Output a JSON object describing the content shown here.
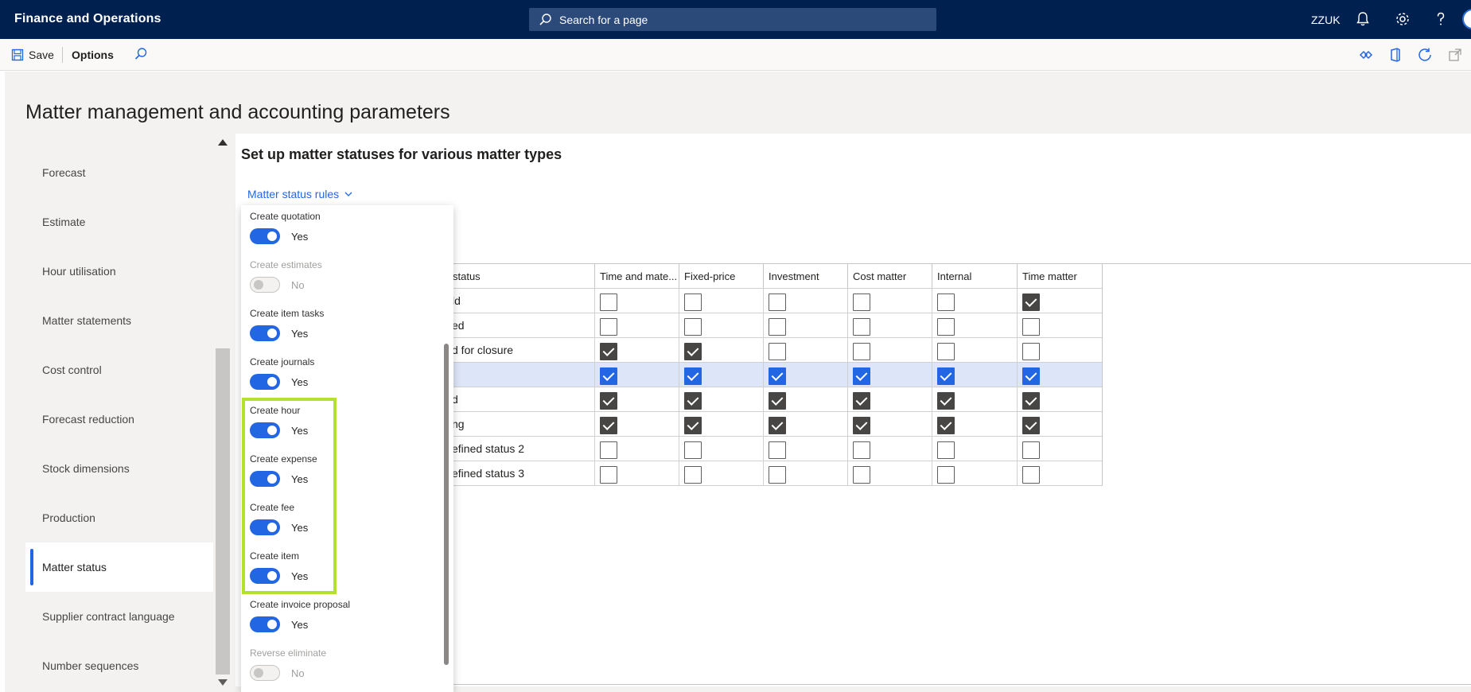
{
  "app": {
    "title": "Finance and Operations",
    "search_placeholder": "Search for a page",
    "company": "ZZUK"
  },
  "actions": {
    "save_label": "Save",
    "options_label": "Options"
  },
  "page": {
    "title": "Matter management and accounting parameters",
    "section_title": "Set up matter statuses for various matter types",
    "rules_link": "Matter status rules"
  },
  "nav": {
    "items": [
      {
        "label": "Forecast"
      },
      {
        "label": "Estimate"
      },
      {
        "label": "Hour utilisation"
      },
      {
        "label": "Matter statements"
      },
      {
        "label": "Cost control"
      },
      {
        "label": "Forecast reduction"
      },
      {
        "label": "Stock dimensions"
      },
      {
        "label": "Production"
      },
      {
        "label": "Matter status"
      },
      {
        "label": "Supplier contract language"
      },
      {
        "label": "Number sequences"
      }
    ],
    "selected": "Matter status"
  },
  "flyout": {
    "items": [
      {
        "label": "Create quotation",
        "value": "Yes",
        "on": true,
        "disabled": false
      },
      {
        "label": "Create estimates",
        "value": "No",
        "on": false,
        "disabled": true
      },
      {
        "label": "Create item tasks",
        "value": "Yes",
        "on": true,
        "disabled": false
      },
      {
        "label": "Create journals",
        "value": "Yes",
        "on": true,
        "disabled": false
      },
      {
        "label": "Create hour",
        "value": "Yes",
        "on": true,
        "disabled": false
      },
      {
        "label": "Create expense",
        "value": "Yes",
        "on": true,
        "disabled": false
      },
      {
        "label": "Create fee",
        "value": "Yes",
        "on": true,
        "disabled": false
      },
      {
        "label": "Create item",
        "value": "Yes",
        "on": true,
        "disabled": false
      },
      {
        "label": "Create invoice proposal",
        "value": "Yes",
        "on": true,
        "disabled": false
      },
      {
        "label": "Reverse eliminate",
        "value": "No",
        "on": false,
        "disabled": true
      }
    ]
  },
  "grid": {
    "columns": [
      {
        "label": "status"
      },
      {
        "label": "Time and mate..."
      },
      {
        "label": "Fixed-price"
      },
      {
        "label": "Investment"
      },
      {
        "label": "Cost matter"
      },
      {
        "label": "Internal"
      },
      {
        "label": "Time matter"
      }
    ],
    "rows": [
      {
        "name": "ld",
        "checks": [
          false,
          false,
          false,
          false,
          false,
          true
        ],
        "selected": false
      },
      {
        "name": "ed",
        "checks": [
          false,
          false,
          false,
          false,
          false,
          false
        ],
        "selected": false
      },
      {
        "name": "d for closure",
        "checks": [
          true,
          true,
          false,
          false,
          false,
          false
        ],
        "selected": false
      },
      {
        "name": "",
        "checks": [
          true,
          true,
          true,
          true,
          true,
          true
        ],
        "selected": true
      },
      {
        "name": "d",
        "checks": [
          true,
          true,
          true,
          true,
          true,
          true
        ],
        "selected": false
      },
      {
        "name": "ng",
        "checks": [
          true,
          true,
          true,
          true,
          true,
          true
        ],
        "selected": false
      },
      {
        "name": "efined status 2",
        "checks": [
          false,
          false,
          false,
          false,
          false,
          false
        ],
        "selected": false
      },
      {
        "name": "efined status 3",
        "checks": [
          false,
          false,
          false,
          false,
          false,
          false
        ],
        "selected": false
      }
    ]
  },
  "colors": {
    "nav_bar": "#002050",
    "accent": "#2266e3",
    "highlight": "#b4e12b"
  }
}
